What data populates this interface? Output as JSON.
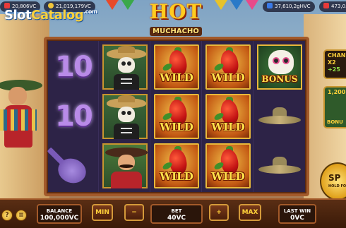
{
  "topbar": {
    "left_balance": "20,806VC",
    "center_balance": "21,019,179VC",
    "right_balance_1": "37,610,2gHVC",
    "right_balance_2": "473,0..."
  },
  "watermark": {
    "text_main": "Slot",
    "text_accent": "Catalog",
    "suffix": ".com"
  },
  "logo": {
    "line1": "HOT",
    "line2": "MUCHACHO"
  },
  "reels": [
    [
      "10",
      "10",
      "guitar"
    ],
    [
      "skeleton",
      "skeleton",
      "mariachi"
    ],
    [
      "WILD",
      "WILD",
      "WILD"
    ],
    [
      "WILD",
      "WILD",
      "WILD"
    ],
    [
      "BONUS",
      "sombrero",
      "sombrero"
    ]
  ],
  "symbols": {
    "wild_label": "WILD",
    "bonus_label": "BONUS",
    "ten_label": "10"
  },
  "side": {
    "chance_label": "CHAN",
    "chance_mult": "X2",
    "chance_plus": "+25",
    "bonus_price": "1,200",
    "bonus_label": "BONU",
    "spin_label": "SP",
    "spin_sub": "HOLD FO"
  },
  "bottom": {
    "balance_label": "BALANCE",
    "balance_value": "100,000VC",
    "min_label": "MIN",
    "minus_label": "−",
    "bet_label": "BET",
    "bet_value": "40VC",
    "plus_label": "+",
    "max_label": "MAX",
    "lastwin_label": "LAST WIN",
    "lastwin_value": "0VC",
    "help_label": "?",
    "menu_label": "≡"
  }
}
